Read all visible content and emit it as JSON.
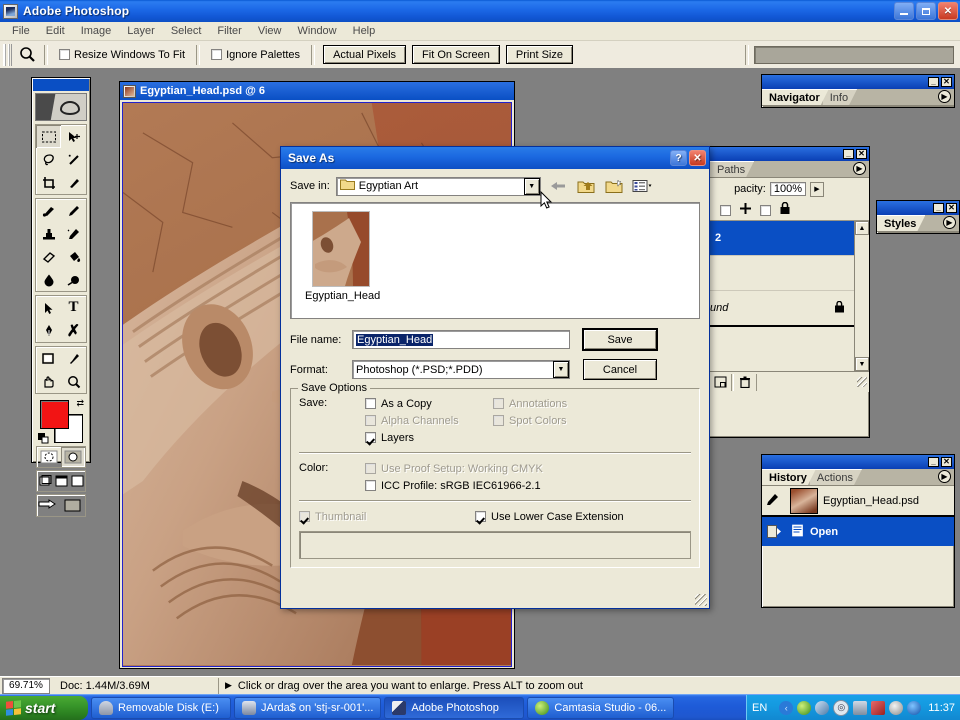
{
  "window": {
    "title": "Adobe Photoshop",
    "minimize": "_",
    "maximize": "□",
    "close": "✕"
  },
  "menubar": {
    "items": [
      "File",
      "Edit",
      "Image",
      "Layer",
      "Select",
      "Filter",
      "View",
      "Window",
      "Help"
    ]
  },
  "optionsbar": {
    "tool_icon": "zoom-tool-icon",
    "resize_windows_label": "Resize Windows To Fit",
    "resize_windows_checked": false,
    "ignore_palettes_label": "Ignore Palettes",
    "ignore_palettes_checked": false,
    "actual_pixels": "Actual Pixels",
    "fit_on_screen": "Fit On Screen",
    "print_size": "Print Size"
  },
  "toolbox": {
    "tools": [
      "marquee-tool",
      "move-tool",
      "lasso-tool",
      "magic-wand-tool",
      "crop-tool",
      "slice-tool",
      "healing-brush-tool",
      "brush-tool",
      "clone-stamp-tool",
      "history-brush-tool",
      "eraser-tool",
      "paint-bucket-tool",
      "blur-tool",
      "dodge-tool",
      "path-selection-tool",
      "type-tool",
      "pen-tool",
      "notes-tool",
      "shape-tool",
      "eyedropper-tool",
      "hand-tool",
      "zoom-tool"
    ],
    "foreground_color": "#f21414",
    "background_color": "#ffffff",
    "mask_modes": [
      "standard-mask-mode",
      "quick-mask-mode"
    ],
    "screen_modes": [
      "standard-screen-mode",
      "full-screen-menubar-mode",
      "full-screen-mode"
    ],
    "jump_to": [
      "jump-to-imageready",
      "jump-preview"
    ]
  },
  "document": {
    "title": "Egyptian_Head.psd @ 6"
  },
  "saveas": {
    "title": "Save As",
    "help_btn": "?",
    "close_btn": "✕",
    "save_in_label": "Save in:",
    "save_in_value": "Egyptian Art",
    "nav_icons": [
      "back-icon",
      "up-one-level-icon",
      "create-new-folder-icon",
      "views-icon"
    ],
    "file_items": [
      {
        "name": "Egyptian_Head"
      }
    ],
    "file_name_label": "File name:",
    "file_name_value": "Egyptian_Head",
    "format_label": "Format:",
    "format_value": "Photoshop (*.PSD;*.PDD)",
    "save_button": "Save",
    "cancel_button": "Cancel",
    "save_options_group": "Save Options",
    "save_label": "Save:",
    "options": [
      {
        "label": "As a Copy",
        "checked": false,
        "enabled": true
      },
      {
        "label": "Annotations",
        "checked": false,
        "enabled": false
      },
      {
        "label": "Alpha Channels",
        "checked": false,
        "enabled": false
      },
      {
        "label": "Spot Colors",
        "checked": false,
        "enabled": false
      },
      {
        "label": "Layers",
        "checked": true,
        "enabled": true
      }
    ],
    "color_label": "Color:",
    "color_options": [
      {
        "label": "Use Proof Setup:  Working CMYK",
        "checked": false,
        "enabled": false
      },
      {
        "label": "ICC Profile:  sRGB IEC61966-2.1",
        "checked": false,
        "enabled": true
      }
    ],
    "thumbnail_label": "Thumbnail",
    "thumbnail_checked": true,
    "thumbnail_enabled": false,
    "lowercase_label": "Use Lower Case Extension",
    "lowercase_checked": true
  },
  "palettes": {
    "navigator": {
      "tabs": [
        {
          "label": "Navigator",
          "active": true
        },
        {
          "label": "Info",
          "active": false
        }
      ],
      "minimize": "_",
      "close": "✕",
      "menu": "▶"
    },
    "layers": {
      "tabs": [
        {
          "label": "Paths",
          "active": false
        }
      ],
      "opacity_label": "pacity:",
      "opacity_value": "100%",
      "minimize": "_",
      "close": "✕",
      "menu": "▶",
      "rows": [
        {
          "label": "2",
          "selected": true
        },
        {
          "label": "",
          "selected": false
        },
        {
          "label": "und",
          "selected": false,
          "locked": true
        }
      ],
      "footer_icons": [
        "layer-style-icon",
        "layer-mask-icon",
        "new-group-icon",
        "adjustment-layer-icon",
        "new-layer-icon",
        "delete-layer-icon"
      ]
    },
    "styles": {
      "tabs": [
        {
          "label": "Styles",
          "active": true
        }
      ],
      "minimize": "_",
      "close": "✕",
      "menu": "▶"
    },
    "history": {
      "tabs": [
        {
          "label": "History",
          "active": true
        },
        {
          "label": "Actions",
          "active": false
        }
      ],
      "minimize": "_",
      "close": "✕",
      "menu": "▶",
      "snapshot": "Egyptian_Head.psd",
      "states": [
        {
          "label": "Open",
          "selected": true
        }
      ]
    }
  },
  "statusbar": {
    "zoom": "69.71%",
    "doc": "Doc: 1.44M/3.69M",
    "arrow": "▶",
    "message": "Click or drag over the area you want to enlarge. Press ALT to zoom out"
  },
  "taskbar": {
    "start": "start",
    "tasks": [
      {
        "label": "Removable Disk (E:)",
        "icon": "disk-icon",
        "active": false
      },
      {
        "label": "JArda$ on 'stj-sr-001'...",
        "icon": "network-drive-icon",
        "active": false
      },
      {
        "label": "Adobe Photoshop",
        "icon": "photoshop-icon",
        "active": true
      },
      {
        "label": "Camtasia Studio - 06...",
        "icon": "camtasia-icon",
        "active": false
      }
    ],
    "language": "EN",
    "tray_icons": [
      "show-hidden-icon",
      "shield-icon",
      "update-icon",
      "antivirus-icon",
      "network-icon",
      "messenger-icon",
      "volume-icon",
      "app-icon"
    ],
    "clock": "11:37"
  },
  "colors": {
    "xp_blue": "#0a4fc4",
    "face_beige": "#ece9d8",
    "workspace_gray": "#808080",
    "accent_red": "#f21414"
  }
}
